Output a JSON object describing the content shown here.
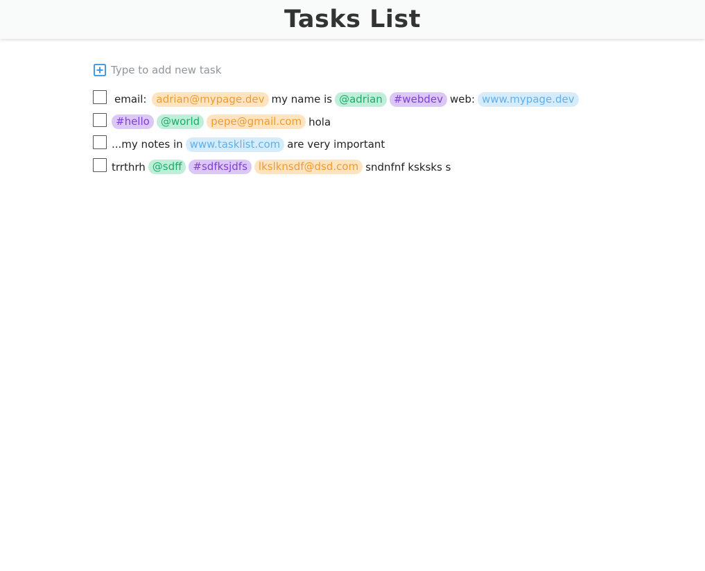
{
  "app": {
    "title": "Tasks List"
  },
  "add_task": {
    "placeholder": "Type to add new task",
    "icon": "plus-square-icon"
  },
  "colors": {
    "email": "#f29b2e",
    "mention": "#1eaa6b",
    "hashtag": "#7f3fd6",
    "link": "#5eb0ee",
    "add_icon": "#2f8fe0"
  },
  "tasks": [
    {
      "checked": false,
      "segments": [
        {
          "type": "text",
          "value": "email:"
        },
        {
          "type": "email",
          "value": "adrian@mypage.dev"
        },
        {
          "type": "text",
          "value": "my name is"
        },
        {
          "type": "mention",
          "value": "@adrian"
        },
        {
          "type": "hashtag",
          "value": "#webdev"
        },
        {
          "type": "text",
          "value": "web:"
        },
        {
          "type": "link",
          "value": "www.mypage.dev"
        }
      ]
    },
    {
      "checked": false,
      "segments": [
        {
          "type": "hashtag",
          "value": "#hello"
        },
        {
          "type": "mention",
          "value": "@world"
        },
        {
          "type": "email",
          "value": "pepe@gmail.com"
        },
        {
          "type": "text",
          "value": "hola"
        }
      ]
    },
    {
      "checked": false,
      "segments": [
        {
          "type": "text",
          "value": "...my notes in"
        },
        {
          "type": "link",
          "value": "www.tasklist.com"
        },
        {
          "type": "text",
          "value": "are very important"
        }
      ]
    },
    {
      "checked": false,
      "segments": [
        {
          "type": "text",
          "value": "trrthrh"
        },
        {
          "type": "mention",
          "value": "@sdff"
        },
        {
          "type": "hashtag",
          "value": "#sdfksjdfs"
        },
        {
          "type": "email",
          "value": "lkslknsdf@dsd.com"
        },
        {
          "type": "text",
          "value": "sndnfnf ksksks s"
        }
      ]
    }
  ]
}
